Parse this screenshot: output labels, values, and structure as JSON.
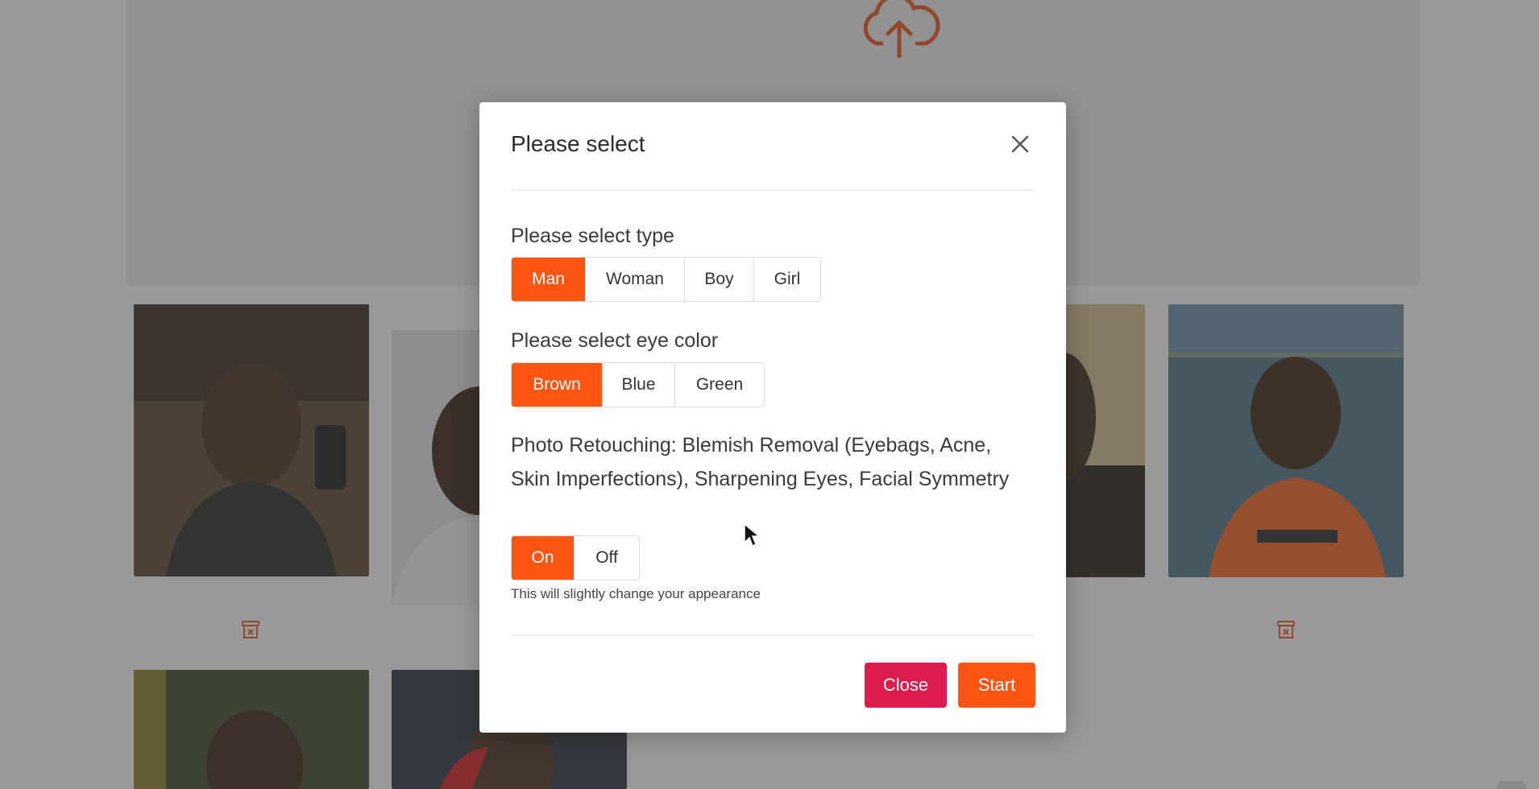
{
  "modal": {
    "title": "Please select",
    "type_section": {
      "label": "Please select type",
      "options": [
        "Man",
        "Woman",
        "Boy",
        "Girl"
      ],
      "selected": "Man"
    },
    "eye_section": {
      "label": "Please select eye color",
      "options": [
        "Brown",
        "Blue",
        "Green"
      ],
      "selected": "Brown"
    },
    "retouch_section": {
      "label": "Photo Retouching: Blemish Removal (Eyebags, Acne, Skin Imperfections), Sharpening Eyes, Facial Symmetry",
      "options": [
        "On",
        "Off"
      ],
      "selected": "On",
      "hint": "This will slightly change your appearance"
    },
    "buttons": {
      "close": "Close",
      "start": "Start"
    }
  },
  "icons": {
    "upload": "cloud-upload-icon",
    "close": "close-icon",
    "delete": "trash-icon",
    "cursor": "mouse-pointer-icon"
  },
  "colors": {
    "accent": "#ff5512",
    "danger": "#dd1c4d",
    "overlay": "rgba(60,60,60,0.5)"
  }
}
